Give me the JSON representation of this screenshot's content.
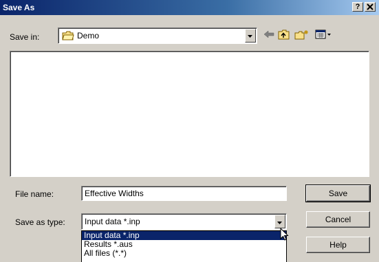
{
  "window": {
    "title": "Save As",
    "help_button": "?",
    "close_button": "×"
  },
  "save_in": {
    "label": "Save in:",
    "value": "Demo",
    "folder_icon": "folder-icon"
  },
  "toolbar": {
    "icons": [
      "back-arrow-icon",
      "up-folder-icon",
      "new-folder-icon",
      "view-menu-icon"
    ]
  },
  "file_name": {
    "label": "File name:",
    "value": "Effective Widths"
  },
  "save_as_type": {
    "label": "Save as type:",
    "value": "Input data *.inp",
    "options": [
      "Input data *.inp",
      "Results *.aus",
      "All files (*.*)"
    ],
    "selected_index": 0
  },
  "buttons": {
    "save": "Save",
    "cancel": "Cancel",
    "help": "Help"
  },
  "colors": {
    "title_start": "#0a246a",
    "title_end": "#a6caf0",
    "face": "#d4d0c8",
    "highlight": "#0a246a"
  }
}
